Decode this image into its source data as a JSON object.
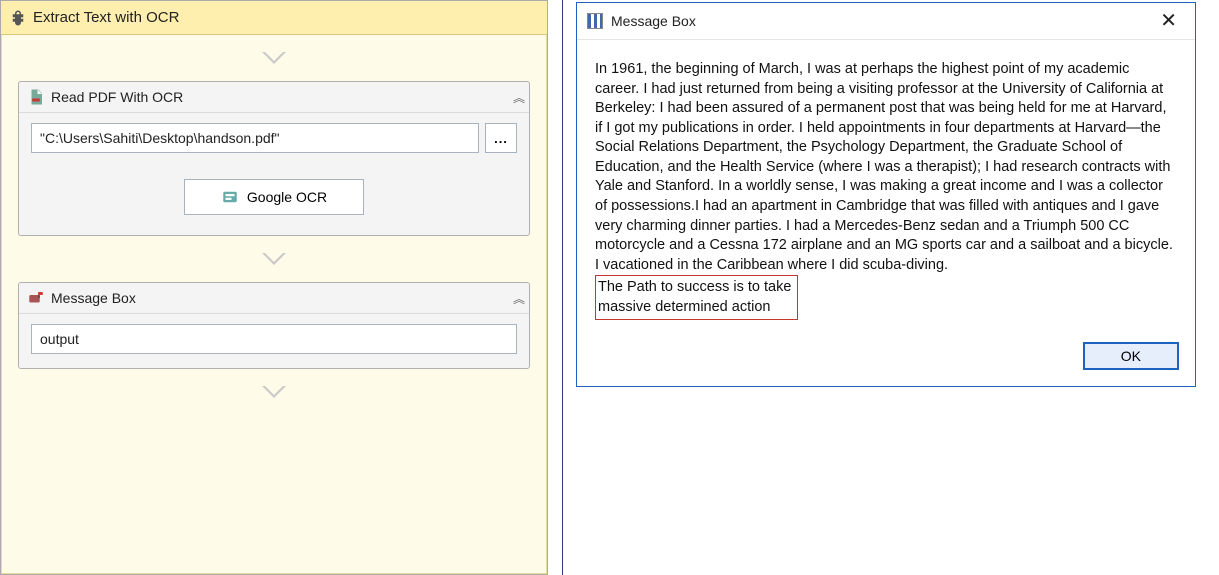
{
  "sequence": {
    "title": "Extract Text with OCR"
  },
  "readPdf": {
    "title": "Read PDF With OCR",
    "path": "\"C:\\Users\\Sahiti\\Desktop\\handson.pdf\"",
    "browse_label": "...",
    "ocr_engine_label": "Google OCR"
  },
  "messageBoxActivity": {
    "title": "Message Box",
    "value": "output"
  },
  "dialog": {
    "title": "Message Box",
    "body_main": "In 1961, the beginning of March, I was at perhaps the highest point of my academic career. I had just returned from being a visiting professor at the University of California at Berkeley: I had been assured of a permanent post that was being held for me at Harvard, if I got my publications in order. I held appointments in four departments at Harvard—the Social Relations Department, the Psychology Department, the Graduate School of Education, and the Health Service (where I was a therapist); I had research contracts with Yale and Stanford. In a worldly sense, I was making a great income and I was a collector of possessions.I had an apartment in Cambridge that was filled with antiques and I gave very charming dinner parties. I had a Mercedes-Benz sedan and a Triumph 500 CC motorcycle and a Cessna 172 airplane and an MG sports car and a sailboat and a bicycle. I vacationed in the Caribbean where I did scuba-diving.",
    "body_highlight_line1": "The Path to success is to take",
    "body_highlight_line2": "massive determined action",
    "ok_label": "OK"
  }
}
